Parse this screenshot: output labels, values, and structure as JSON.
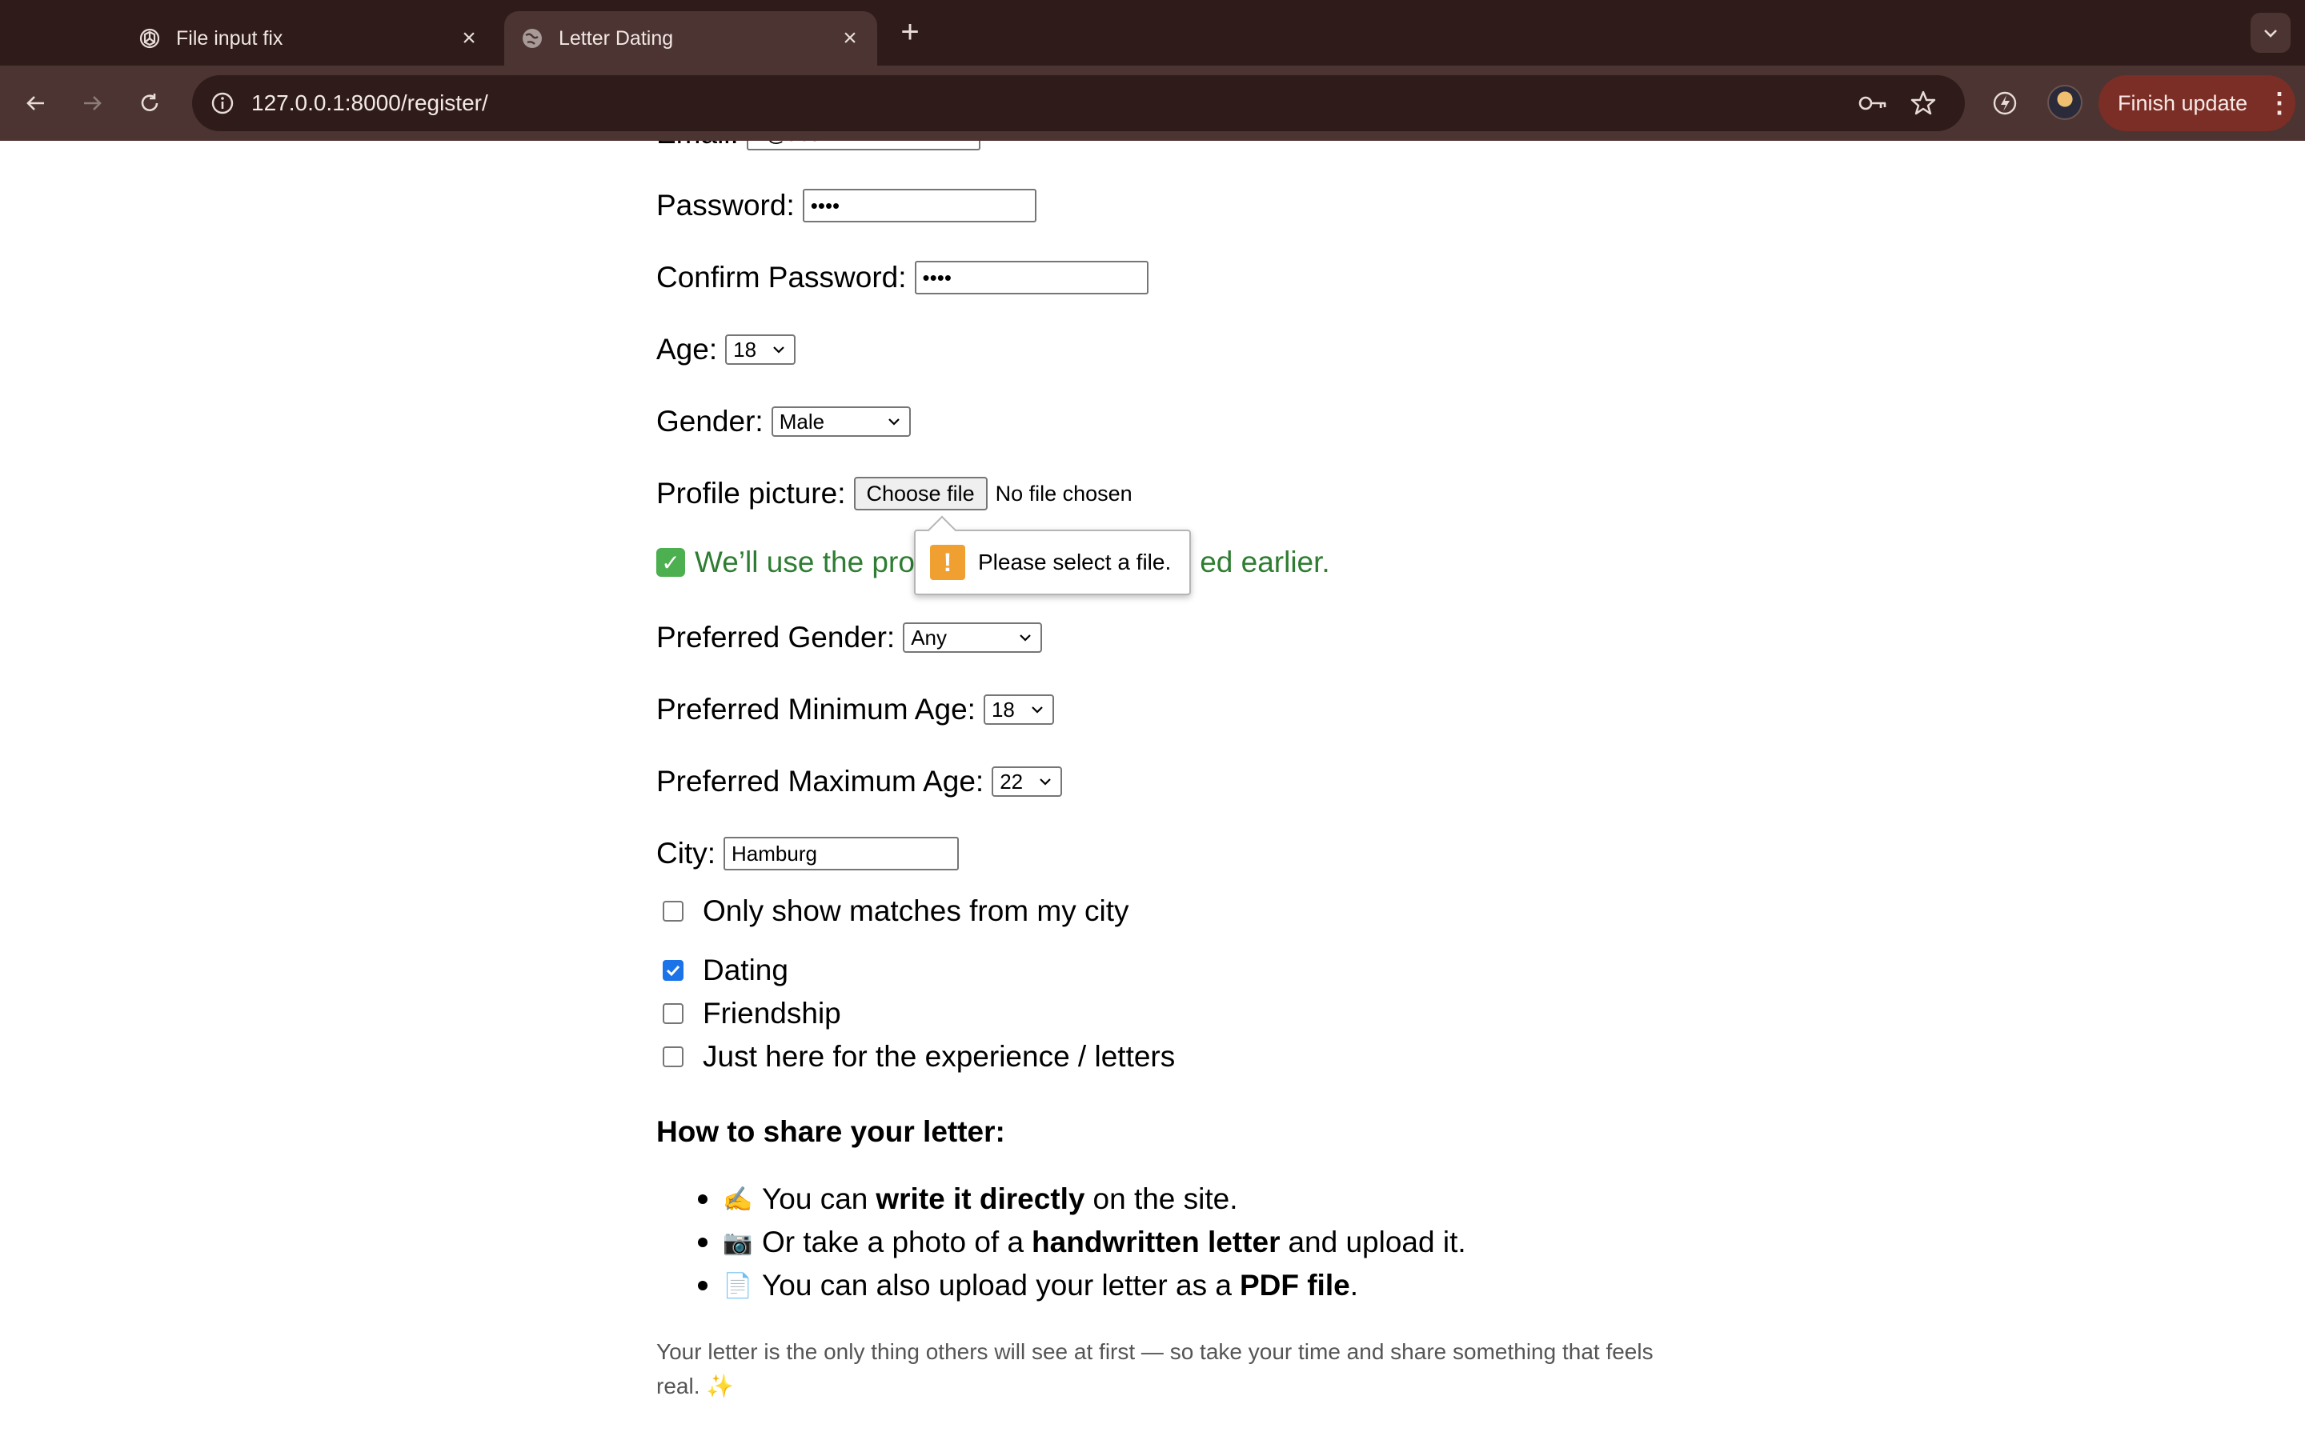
{
  "browser": {
    "tabs": [
      {
        "title": "File input fix",
        "icon": "openai-icon",
        "active": false
      },
      {
        "title": "Letter Dating",
        "icon": "globe-icon",
        "active": true
      }
    ],
    "url": "127.0.0.1:8000/register/",
    "finish_update": "Finish update"
  },
  "form": {
    "email_label": "Email:",
    "email_value": "h@t.com",
    "password_label": "Password:",
    "password_value": "••••",
    "confirm_label": "Confirm Password:",
    "confirm_value": "••••",
    "age_label": "Age:",
    "age_value": "18",
    "gender_label": "Gender:",
    "gender_value": "Male",
    "picture_label": "Profile picture:",
    "choose_file": "Choose file",
    "no_file": "No file chosen",
    "note_start": "We’ll use the prof",
    "note_end": "ed earlier.",
    "validation_message": "Please select a file.",
    "pref_gender_label": "Preferred Gender:",
    "pref_gender_value": "Any",
    "pref_min_label": "Preferred Minimum Age:",
    "pref_min_value": "18",
    "pref_max_label": "Preferred Maximum Age:",
    "pref_max_value": "22",
    "city_label": "City:",
    "city_value": "Hamburg",
    "only_city_label": "Only show matches from my city",
    "only_city_checked": false,
    "intents": [
      {
        "label": "Dating",
        "checked": true
      },
      {
        "label": "Friendship",
        "checked": false
      },
      {
        "label": "Just here for the experience / letters",
        "checked": false
      }
    ]
  },
  "share": {
    "heading": "How to share your letter:",
    "items": [
      {
        "emoji": "✍️",
        "before": "You can",
        "bold": "write it directly",
        "after": "on the site."
      },
      {
        "emoji": "📷",
        "before": "Or take a photo of a",
        "bold": "handwritten letter",
        "after": "and upload it."
      },
      {
        "emoji": "📄",
        "before": "You can also upload your letter as a",
        "bold": "PDF file",
        "after": "."
      }
    ],
    "footnote": "Your letter is the only thing others will see at first — so take your time and share something that feels real. ✨"
  }
}
